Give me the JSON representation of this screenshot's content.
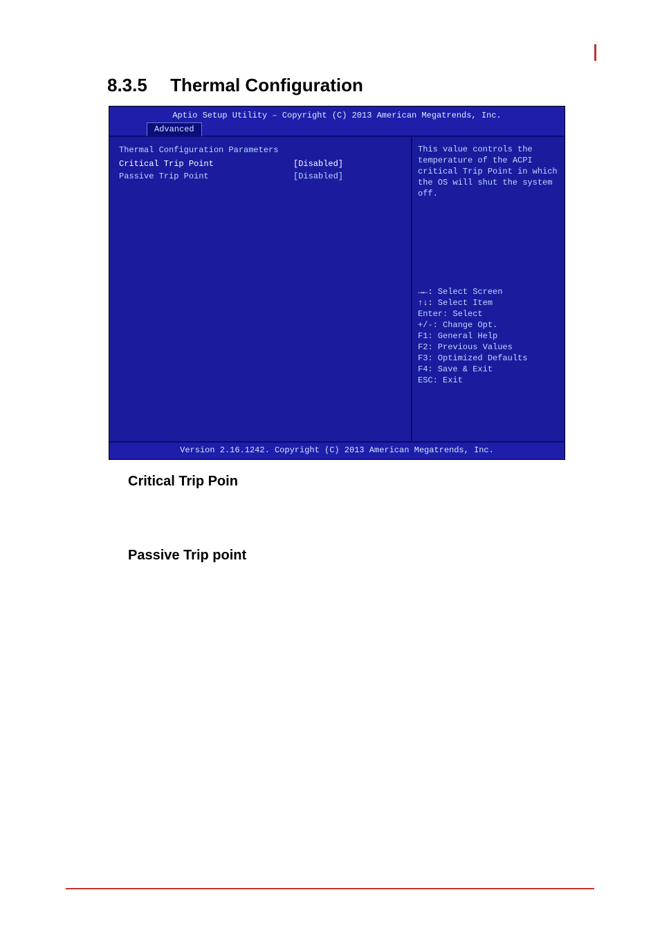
{
  "section": {
    "number": "8.3.5",
    "title": "Thermal Configuration"
  },
  "bios": {
    "top_title": "Aptio Setup Utility – Copyright (C) 2013 American Megatrends, Inc.",
    "tab": "Advanced",
    "left": {
      "header": "Thermal Configuration Parameters",
      "options": [
        {
          "label": "Critical Trip Point",
          "value": "[Disabled]",
          "selected": true
        },
        {
          "label": "Passive Trip Point",
          "value": "[Disabled]",
          "selected": false
        }
      ]
    },
    "help": "This value controls the temperature of the ACPI critical Trip Point in which the OS will shut the system off.",
    "keys": {
      "k1_sym": "→←:",
      "k1_txt": " Select Screen",
      "k2_sym": "↑↓:",
      "k2_txt": " Select Item",
      "k3": "Enter: Select",
      "k4": "+/-: Change Opt.",
      "k5": "F1: General Help",
      "k6": "F2: Previous Values",
      "k7": "F3: Optimized Defaults",
      "k8": "F4: Save & Exit",
      "k9": "ESC: Exit"
    },
    "footer": "Version 2.16.1242. Copyright (C) 2013 American Megatrends, Inc."
  },
  "subheads": {
    "s1": "Critical Trip Poin",
    "s2": "Passive Trip point"
  }
}
